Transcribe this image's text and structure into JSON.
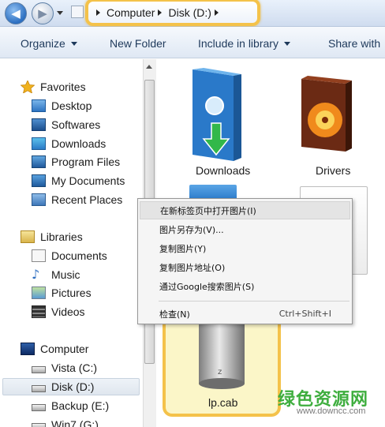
{
  "address": {
    "crumbs": [
      "Computer",
      "Disk (D:)"
    ]
  },
  "toolbar": {
    "organize": "Organize",
    "new_folder": "New Folder",
    "include_in_library": "Include in library",
    "share_with": "Share with"
  },
  "nav": {
    "favorites": "Favorites",
    "favorites_items": [
      "Desktop",
      "Softwares",
      "Downloads",
      "Program Files",
      "My Documents",
      "Recent Places"
    ],
    "libraries": "Libraries",
    "libraries_items": [
      "Documents",
      "Music",
      "Pictures",
      "Videos"
    ],
    "computer": "Computer",
    "computer_items": [
      "Vista (C:)",
      "Disk (D:)",
      "Backup (E:)",
      "Win7 (G:)"
    ]
  },
  "items": {
    "downloads": "Downloads",
    "drivers": "Drivers",
    "cab": "lp.cab"
  },
  "context_menu": {
    "items": [
      "在新标签页中打开图片(I)",
      "图片另存为(V)...",
      "复制图片(Y)",
      "复制图片地址(O)",
      "通过Google搜索图片(S)"
    ],
    "inspect": "检查(N)",
    "inspect_shortcut": "Ctrl+Shift+I"
  },
  "watermark": {
    "text": "绿色资源网",
    "url": "www.downcc.com"
  }
}
